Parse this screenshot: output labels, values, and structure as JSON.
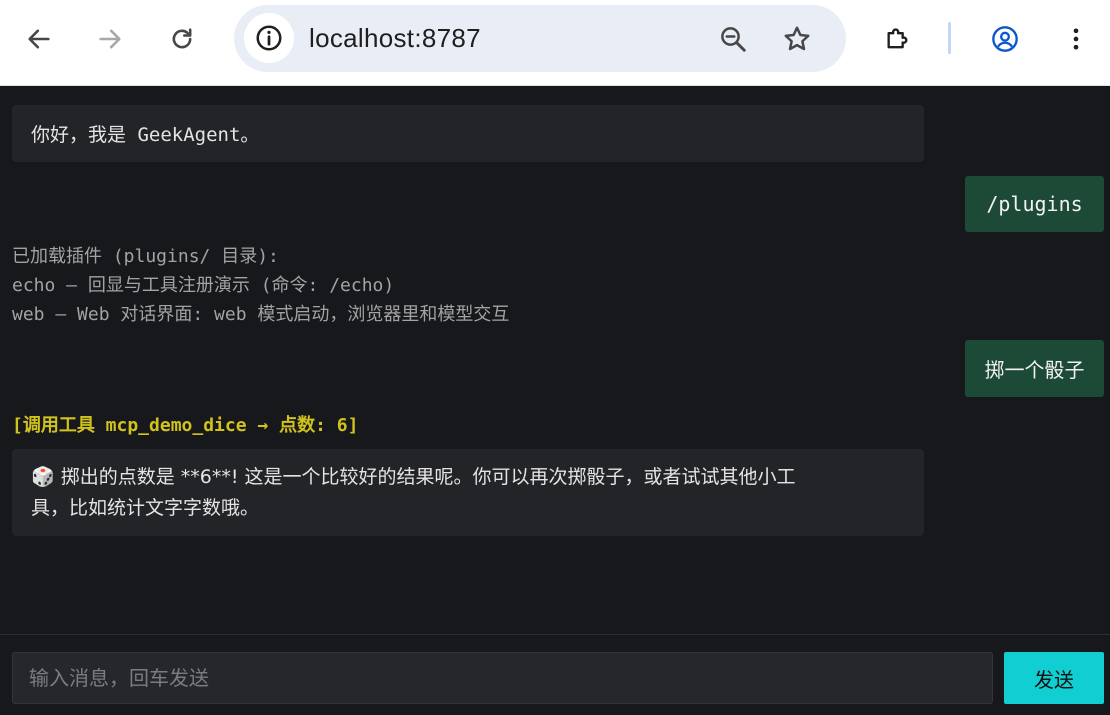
{
  "browser": {
    "url": "localhost:8787",
    "icons": {
      "back": "arrow-left-icon",
      "forward": "arrow-right-icon",
      "reload": "reload-icon",
      "info": "info-icon",
      "zoom": "zoom-out-icon",
      "bookmark": "star-icon",
      "extensions": "puzzle-icon",
      "profile": "account-circle-icon",
      "menu": "kebab-menu-icon"
    }
  },
  "chat": {
    "welcome": "你好，我是 GeekAgent。",
    "user_command": "/plugins",
    "plugin_list": {
      "header": "已加载插件 (plugins/ 目录):",
      "line1": "echo — 回显与工具注册演示 (命令: /echo)",
      "line2": "web — Web 对话界面: web 模式启动，浏览器里和模型交互"
    },
    "user_message": "掷一个骰子",
    "tool_call": "[调用工具 mcp_demo_dice → 点数: 6]",
    "reply_icon": "🎲",
    "reply_line1": "掷出的点数是 **6**! 这是一个比较好的结果呢。你可以再次掷骰子，或者试试其他小工",
    "reply_line2": "具，比如统计文字字数哦。"
  },
  "composer": {
    "placeholder": "输入消息，回车发送",
    "send_label": "发送"
  },
  "colors": {
    "background": "#17181c",
    "assistant_bubble": "#232428",
    "user_bubble": "#1d4a37",
    "tool_text": "#d1c21c",
    "send_button": "#11ced2"
  }
}
